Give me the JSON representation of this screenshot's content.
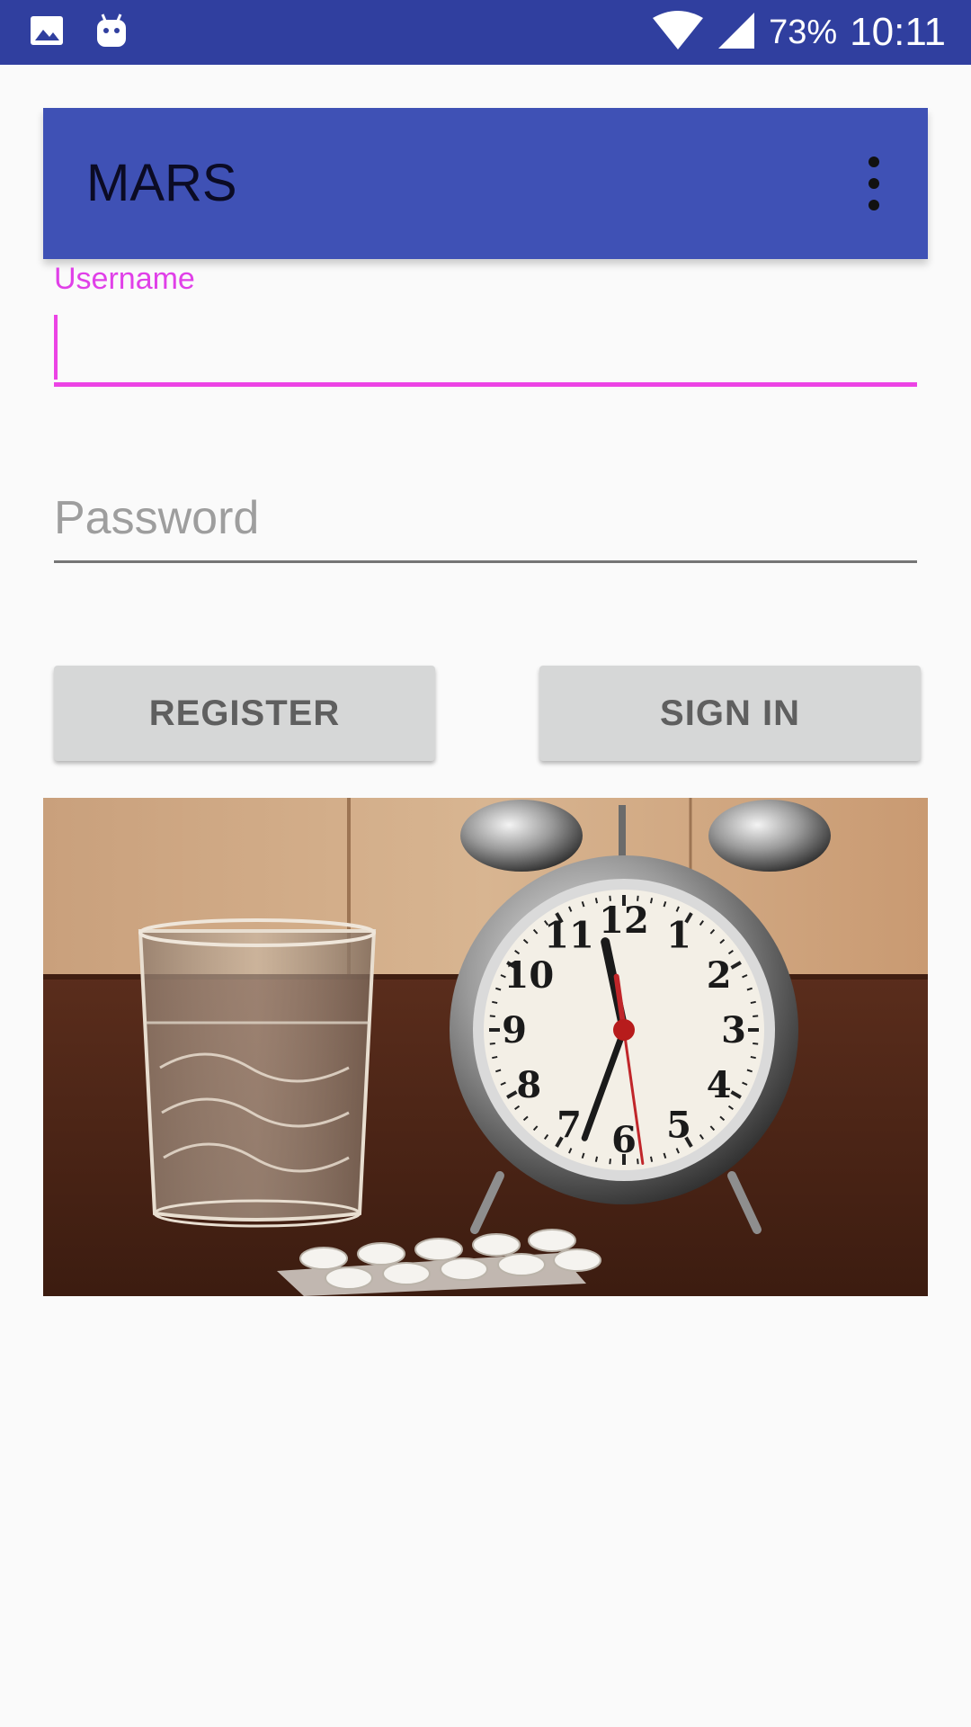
{
  "status_bar": {
    "icons": [
      "image-icon",
      "android-icon",
      "wifi-icon",
      "signal-icon"
    ],
    "battery": "73%",
    "time": "10:11",
    "background": "#303f9f"
  },
  "app_bar": {
    "title": "MARS",
    "menu_icon": "more-vert-icon",
    "background": "#3f51b5"
  },
  "form": {
    "username": {
      "label": "Username",
      "value": "",
      "accent": "#ec43e5"
    },
    "password": {
      "placeholder": "Password",
      "value": ""
    },
    "buttons": {
      "register": "REGISTER",
      "sign_in": "SIGN IN"
    }
  },
  "clock_numerals": [
    "12",
    "1",
    "2",
    "3",
    "4",
    "5",
    "6",
    "7",
    "8",
    "9",
    "10",
    "11"
  ]
}
